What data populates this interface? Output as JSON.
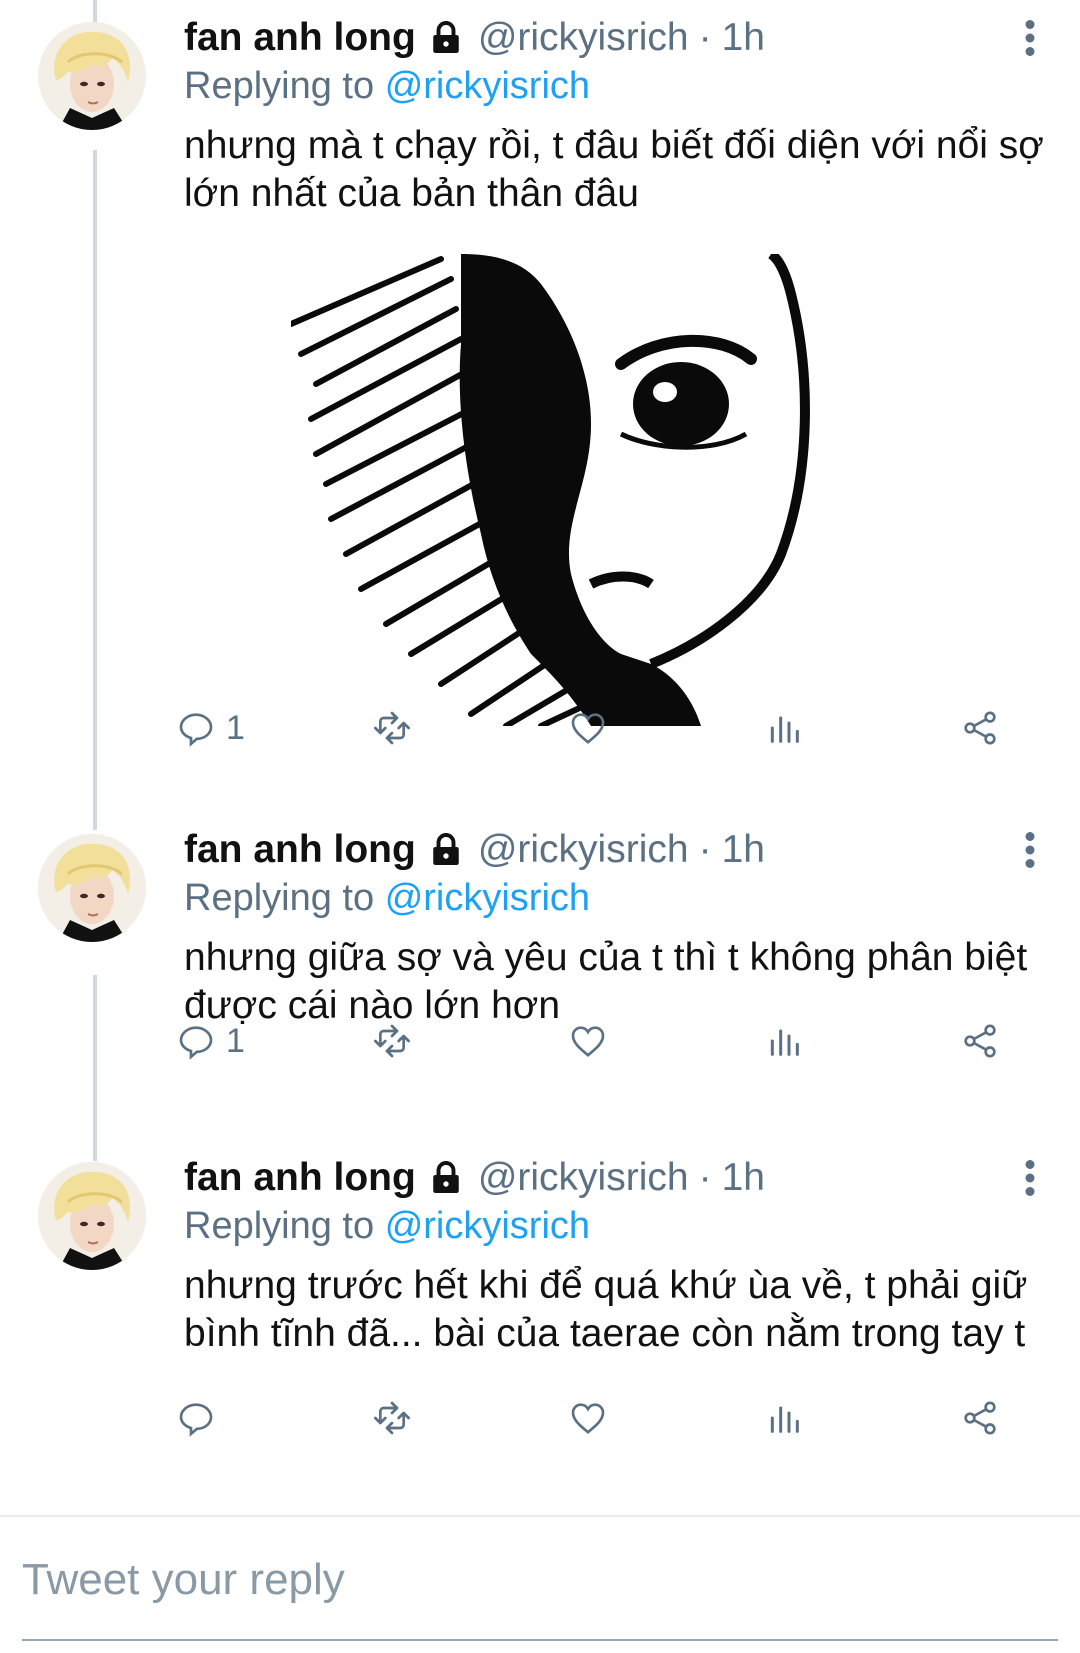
{
  "colors": {
    "accent": "#1da1f2",
    "secondary_text": "#5b7083",
    "thread_line": "#cfd9de"
  },
  "tweets": [
    {
      "name": "fan anh long",
      "handle": "@rickyisrich",
      "separator": "·",
      "time": "1h",
      "replying_prefix": "Replying to",
      "replying_to": "@rickyisrich",
      "text": "nhưng mà t chạy rồi, t đâu biết đối diện với nổi sợ lớn nhất của bản thân đâu",
      "has_media": true,
      "media_icon": "manga-face-drawing",
      "reply_count": "1"
    },
    {
      "name": "fan anh long",
      "handle": "@rickyisrich",
      "separator": "·",
      "time": "1h",
      "replying_prefix": "Replying to",
      "replying_to": "@rickyisrich",
      "text": "nhưng giữa sợ và yêu của t thì t không phân biệt được cái nào lớn hơn",
      "has_media": false,
      "reply_count": "1"
    },
    {
      "name": "fan anh long",
      "handle": "@rickyisrich",
      "separator": "·",
      "time": "1h",
      "replying_prefix": "Replying to",
      "replying_to": "@rickyisrich",
      "text": "nhưng trước hết khi để quá khứ ùa về, t phải giữ bình tĩnh đã... bài của taerae còn nằm trong tay t",
      "has_media": false,
      "reply_count": ""
    }
  ],
  "icons": [
    "lock-icon",
    "more-icon",
    "reply-icon",
    "retweet-icon",
    "like-icon",
    "analytics-icon",
    "share-icon"
  ],
  "reply_bar": {
    "placeholder": "Tweet your reply"
  }
}
